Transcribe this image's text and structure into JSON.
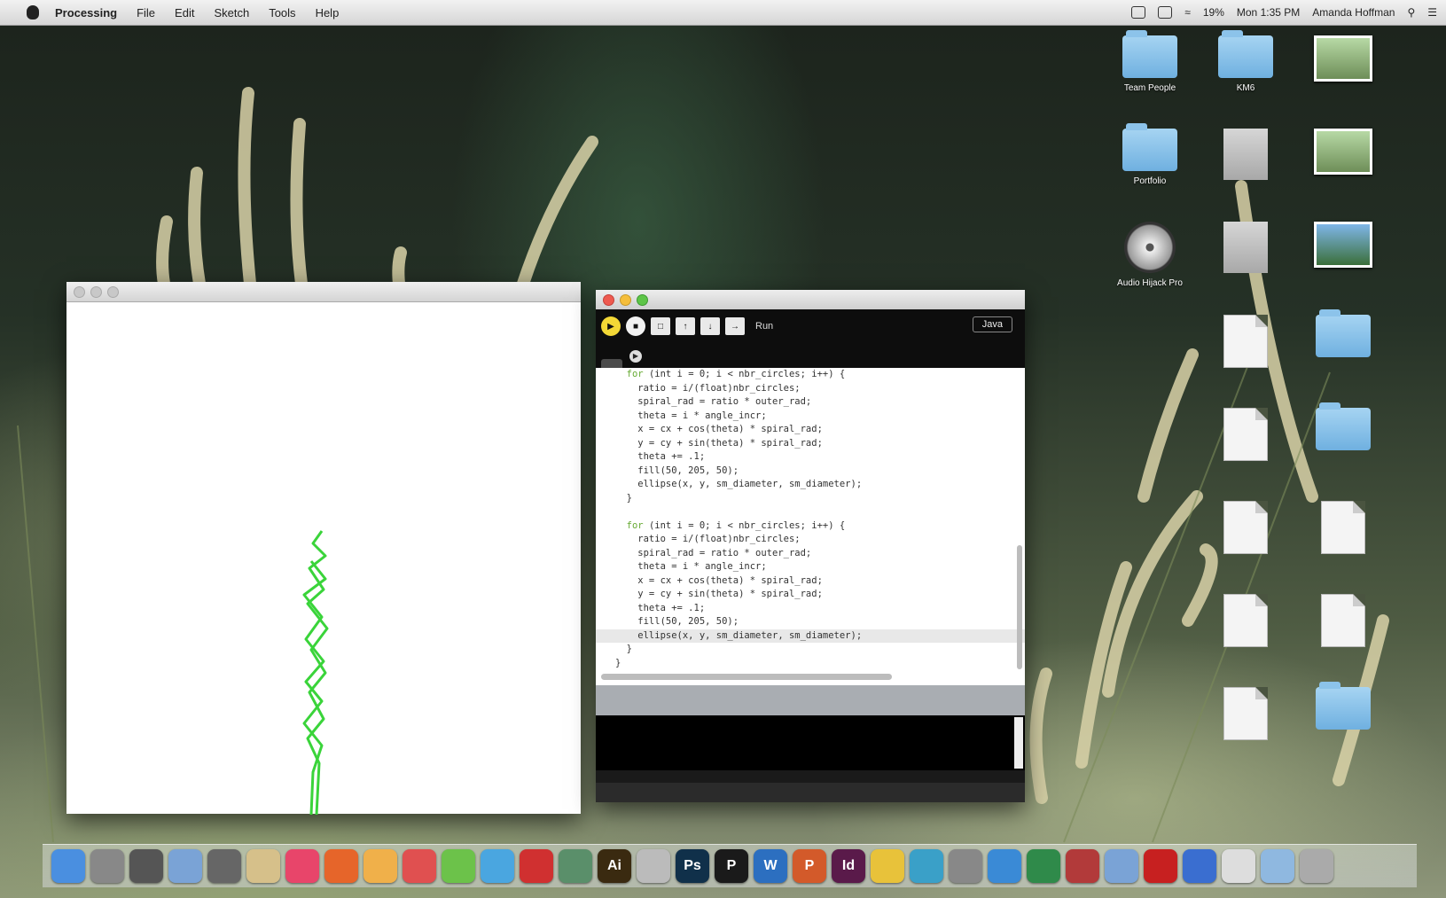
{
  "menubar": {
    "app_name": "Processing",
    "menus": [
      "File",
      "Edit",
      "Sketch",
      "Tools",
      "Help"
    ],
    "clock": "Mon 1:35 PM",
    "user": "Amanda Hoffman",
    "battery": "19%"
  },
  "desktop_icons": [
    {
      "label": "Team People",
      "type": "folder"
    },
    {
      "label": "KM6",
      "type": "folder"
    },
    {
      "label": "",
      "type": "photo"
    },
    {
      "label": "Portfolio",
      "type": "folder"
    },
    {
      "label": "",
      "type": "greydoc"
    },
    {
      "label": "",
      "type": "photo"
    },
    {
      "label": "Audio Hijack Pro",
      "type": "disc"
    },
    {
      "label": "",
      "type": "greydoc"
    },
    {
      "label": "",
      "type": "photo-blue"
    },
    {
      "label": "",
      "type": "doc"
    },
    {
      "label": "",
      "type": "folder"
    },
    {
      "label": "",
      "type": "doc"
    },
    {
      "label": "",
      "type": "folder"
    },
    {
      "label": "",
      "type": "doc"
    },
    {
      "label": "",
      "type": "doc"
    },
    {
      "label": "",
      "type": "doc"
    },
    {
      "label": "",
      "type": "doc"
    },
    {
      "label": "",
      "type": "doc"
    },
    {
      "label": "",
      "type": "folder"
    }
  ],
  "sketch_window": {
    "title": ""
  },
  "ide": {
    "title": "",
    "toolbar_hint": "Run",
    "mode": "Java",
    "tab": "",
    "code_lines": [
      {
        "t": "  for (int i = 0; i < nbr_circles; i++) {",
        "c": "kw"
      },
      {
        "t": "    ratio = i/(float)nbr_circles;",
        "c": ""
      },
      {
        "t": "    spiral_rad = ratio * outer_rad;",
        "c": ""
      },
      {
        "t": "    theta = i * angle_incr;",
        "c": ""
      },
      {
        "t": "    x = cx + cos(theta) * spiral_rad;",
        "c": ""
      },
      {
        "t": "    y = cy + sin(theta) * spiral_rad;",
        "c": ""
      },
      {
        "t": "    theta += .1;",
        "c": ""
      },
      {
        "t": "    fill(50, 205, 50);",
        "c": ""
      },
      {
        "t": "    ellipse(x, y, sm_diameter, sm_diameter);",
        "c": ""
      },
      {
        "t": "  }",
        "c": ""
      },
      {
        "t": "",
        "c": ""
      },
      {
        "t": "  for (int i = 0; i < nbr_circles; i++) {",
        "c": "kw"
      },
      {
        "t": "    ratio = i/(float)nbr_circles;",
        "c": ""
      },
      {
        "t": "    spiral_rad = ratio * outer_rad;",
        "c": ""
      },
      {
        "t": "    theta = i * angle_incr;",
        "c": ""
      },
      {
        "t": "    x = cx + cos(theta) * spiral_rad;",
        "c": ""
      },
      {
        "t": "    y = cy + sin(theta) * spiral_rad;",
        "c": ""
      },
      {
        "t": "    theta += .1;",
        "c": ""
      },
      {
        "t": "    fill(50, 205, 50);",
        "c": ""
      },
      {
        "t": "    ellipse(x, y, sm_diameter, sm_diameter);",
        "c": "hl"
      },
      {
        "t": "  }",
        "c": ""
      },
      {
        "t": "}",
        "c": ""
      }
    ]
  },
  "dock": {
    "apps": [
      {
        "name": "Finder",
        "color": "#4a8fe0",
        "glyph": ""
      },
      {
        "name": "Launchpad",
        "color": "#888",
        "glyph": ""
      },
      {
        "name": "Mission Control",
        "color": "#555",
        "glyph": ""
      },
      {
        "name": "Preview",
        "color": "#7aa3d6",
        "glyph": ""
      },
      {
        "name": "Image Capture",
        "color": "#666",
        "glyph": ""
      },
      {
        "name": "Notes",
        "color": "#d6c08a",
        "glyph": ""
      },
      {
        "name": "iTunes",
        "color": "#e8456a",
        "glyph": ""
      },
      {
        "name": "Firefox",
        "color": "#e6652a",
        "glyph": ""
      },
      {
        "name": "Growl",
        "color": "#f0b04a",
        "glyph": ""
      },
      {
        "name": "Calendar",
        "color": "#e05050",
        "glyph": ""
      },
      {
        "name": "Spotify",
        "color": "#6cc24a",
        "glyph": ""
      },
      {
        "name": "Safari",
        "color": "#4aa6e0",
        "glyph": ""
      },
      {
        "name": "Flash",
        "color": "#d03030",
        "glyph": ""
      },
      {
        "name": "App",
        "color": "#5a8f6a",
        "glyph": ""
      },
      {
        "name": "Illustrator",
        "color": "#3a2a10",
        "glyph": "Ai"
      },
      {
        "name": "Sketchbook",
        "color": "#bbb",
        "glyph": ""
      },
      {
        "name": "Photoshop",
        "color": "#10304a",
        "glyph": "Ps"
      },
      {
        "name": "Processing-P",
        "color": "#1a1a1a",
        "glyph": "P"
      },
      {
        "name": "Word",
        "color": "#2c6fc0",
        "glyph": "W"
      },
      {
        "name": "PowerPoint",
        "color": "#d35a2a",
        "glyph": "P"
      },
      {
        "name": "InDesign",
        "color": "#5a1a4a",
        "glyph": "Id"
      },
      {
        "name": "Norton",
        "color": "#e8c23a",
        "glyph": ""
      },
      {
        "name": "Map",
        "color": "#3aa0c8",
        "glyph": ""
      },
      {
        "name": "Tools",
        "color": "#888",
        "glyph": ""
      },
      {
        "name": "Globe",
        "color": "#3a8ad6",
        "glyph": ""
      },
      {
        "name": "Excel",
        "color": "#2f8a4a",
        "glyph": ""
      },
      {
        "name": "Dictionary",
        "color": "#b23a3a",
        "glyph": ""
      },
      {
        "name": "Preview2",
        "color": "#7aa3d6",
        "glyph": ""
      },
      {
        "name": "Acrobat",
        "color": "#c72020",
        "glyph": ""
      },
      {
        "name": "Spotlight",
        "color": "#3a6ed0",
        "glyph": ""
      },
      {
        "name": "Installer",
        "color": "#ddd",
        "glyph": ""
      },
      {
        "name": "Documents",
        "color": "#8fb8e0",
        "glyph": ""
      },
      {
        "name": "Trash",
        "color": "#aaa",
        "glyph": ""
      }
    ]
  }
}
